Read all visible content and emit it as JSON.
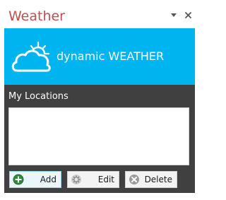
{
  "pane": {
    "title": "Weather",
    "menu_icon": "dropdown-arrow-icon",
    "close_icon": "close-icon"
  },
  "banner": {
    "logo_icon": "sun-cloud-icon",
    "text": "dynamic WEATHER",
    "background_color": "#00b4f0"
  },
  "locations": {
    "label": "My Locations",
    "items": []
  },
  "buttons": {
    "add": {
      "label": "Add",
      "icon": "add-icon"
    },
    "edit": {
      "label": "Edit",
      "icon": "gear-icon"
    },
    "delete": {
      "label": "Delete",
      "icon": "delete-icon"
    }
  },
  "colors": {
    "title": "#c0504d",
    "panel": "#404040",
    "add_icon": "#2e8b3a"
  }
}
